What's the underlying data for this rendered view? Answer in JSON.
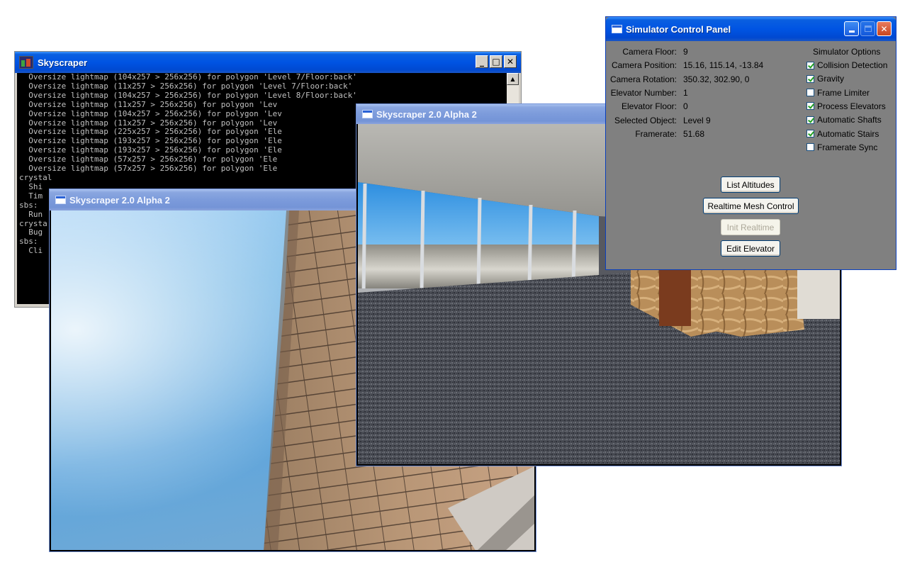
{
  "console": {
    "title": "Skyscraper",
    "lines": [
      "  Oversize lightmap (104x257 > 256x256) for polygon 'Level 7/Floor:back'",
      "  Oversize lightmap (11x257 > 256x256) for polygon 'Level 7/Floor:back'",
      "  Oversize lightmap (104x257 > 256x256) for polygon 'Level 8/Floor:back'",
      "  Oversize lightmap (11x257 > 256x256) for polygon 'Lev",
      "  Oversize lightmap (104x257 > 256x256) for polygon 'Lev",
      "  Oversize lightmap (11x257 > 256x256) for polygon 'Lev",
      "  Oversize lightmap (225x257 > 256x256) for polygon 'Ele",
      "  Oversize lightmap (193x257 > 256x256) for polygon 'Ele",
      "  Oversize lightmap (193x257 > 256x256) for polygon 'Ele",
      "  Oversize lightmap (57x257 > 256x256) for polygon 'Ele",
      "  Oversize lightmap (57x257 > 256x256) for polygon 'Ele",
      "",
      "crystal",
      "  Shi",
      "  Tim",
      "",
      "sbs:",
      "  Run",
      "",
      "crysta",
      "  Bug",
      "",
      "sbs:",
      "  Cli"
    ],
    "minimize_label": "_",
    "maximize_label": "□",
    "close_label": "✕",
    "scroll_up_label": "▲"
  },
  "render_window_1": {
    "title": "Skyscraper 2.0 Alpha 2"
  },
  "render_window_2": {
    "title": "Skyscraper 2.0 Alpha 2"
  },
  "control_panel": {
    "title": "Simulator Control Panel",
    "info": [
      {
        "label": "Camera Floor:",
        "value": "9"
      },
      {
        "label": "Camera Position:",
        "value": "15.16, 115.14, -13.84"
      },
      {
        "label": "Camera Rotation:",
        "value": "350.32, 302.90, 0"
      },
      {
        "label": "Elevator Number:",
        "value": "1"
      },
      {
        "label": "Elevator Floor:",
        "value": "0"
      },
      {
        "label": "Selected Object:",
        "value": "Level 9"
      },
      {
        "label": "Framerate:",
        "value": "51.68"
      }
    ],
    "options_title": "Simulator Options",
    "options": [
      {
        "label": "Collision Detection",
        "checked": true
      },
      {
        "label": "Gravity",
        "checked": true
      },
      {
        "label": "Frame Limiter",
        "checked": false
      },
      {
        "label": "Process Elevators",
        "checked": true
      },
      {
        "label": "Automatic Shafts",
        "checked": true
      },
      {
        "label": "Automatic Stairs",
        "checked": true
      },
      {
        "label": "Framerate Sync",
        "checked": false
      }
    ],
    "buttons": {
      "list_altitudes": "List Altitudes",
      "realtime_mesh": "Realtime Mesh Control",
      "init_realtime": "Init Realtime",
      "edit_elevator": "Edit Elevator"
    },
    "close_label": "✕"
  },
  "colors": {
    "titlebar_active": "#0054e3",
    "panel_background": "#808080",
    "checkmark": "#21a121"
  }
}
